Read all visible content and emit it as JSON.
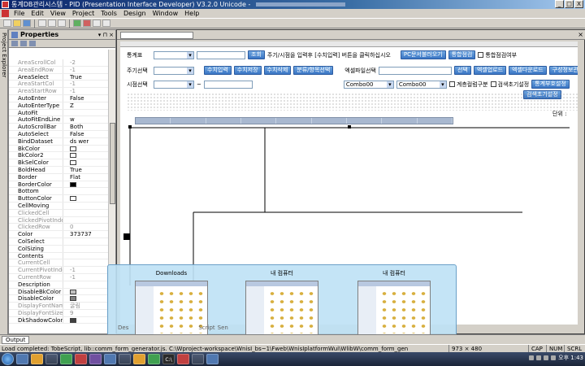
{
  "window": {
    "title": "통계DB관리시스템 - PID (Presentation Interface Developer) V3.2.0 Unicode - ",
    "controls": [
      "_",
      "□",
      "X"
    ]
  },
  "menu": [
    "File",
    "Edit",
    "View",
    "Project",
    "Tools",
    "Design",
    "Window",
    "Help"
  ],
  "side_tab": "Project Explorer",
  "properties": {
    "title": "Properties",
    "rows": [
      {
        "name": "AreaScrollCol",
        "value": "-2",
        "dim": true
      },
      {
        "name": "AreaEndRow",
        "value": "-1",
        "dim": true
      },
      {
        "name": "AreaSelect",
        "value": "True",
        "dim": false
      },
      {
        "name": "AreaStartCol",
        "value": "-1",
        "dim": true
      },
      {
        "name": "AreaStartRow",
        "value": "-1",
        "dim": true
      },
      {
        "name": "AutoEnter",
        "value": "False",
        "dim": false
      },
      {
        "name": "AutoEnterType",
        "value": "Z",
        "dim": false
      },
      {
        "name": "AutoFit",
        "value": "",
        "dim": false
      },
      {
        "name": "AutoFitEndLine",
        "value": "w",
        "dim": false
      },
      {
        "name": "AutoScrollBar",
        "value": "Both",
        "dim": false
      },
      {
        "name": "AutoSelect",
        "value": "False",
        "dim": false
      },
      {
        "name": "BindDataset",
        "value": "ds     wer",
        "dim": false
      },
      {
        "name": "BkColor",
        "value": "",
        "dim": false,
        "swatch": "#ffffff"
      },
      {
        "name": "BkColor2",
        "value": "",
        "dim": false,
        "swatch": "#ffffff"
      },
      {
        "name": "BkSelColor",
        "value": "",
        "dim": false,
        "swatch": "#ffffff"
      },
      {
        "name": "BoldHead",
        "value": "True",
        "dim": false
      },
      {
        "name": "Border",
        "value": "Flat",
        "dim": false
      },
      {
        "name": "BorderColor",
        "value": "",
        "dim": false,
        "swatch": "#000000"
      },
      {
        "name": "Bottom",
        "value": "",
        "dim": false
      },
      {
        "name": "ButtonColor",
        "value": "",
        "dim": false,
        "swatch": "#ffffff"
      },
      {
        "name": "CellMoving",
        "value": "",
        "dim": false
      },
      {
        "name": "ClickedCell",
        "value": "",
        "dim": true
      },
      {
        "name": "ClickedPivotIndex",
        "value": "",
        "dim": true
      },
      {
        "name": "ClickedRow",
        "value": "0",
        "dim": true
      },
      {
        "name": "Color",
        "value": "373737",
        "dim": false
      },
      {
        "name": "ColSelect",
        "value": "",
        "dim": false
      },
      {
        "name": "ColSizing",
        "value": "",
        "dim": false
      },
      {
        "name": "Contents",
        "value": "",
        "dim": false
      },
      {
        "name": "CurrentCell",
        "value": "",
        "dim": true
      },
      {
        "name": "CurrentPivotIndex",
        "value": "-1",
        "dim": true
      },
      {
        "name": "CurrentRow",
        "value": "-1",
        "dim": true
      },
      {
        "name": "Description",
        "value": "",
        "dim": false
      },
      {
        "name": "DisableBkColor",
        "value": "",
        "dim": false,
        "swatch": "#c0c0c0"
      },
      {
        "name": "DisableColor",
        "value": "",
        "dim": false,
        "swatch": "#808080"
      },
      {
        "name": "DisplayFontName",
        "value": "굴림",
        "dim": true
      },
      {
        "name": "DisplayFontSize",
        "value": "9",
        "dim": true
      },
      {
        "name": "DkShadowColor",
        "value": "",
        "dim": false,
        "swatch": "#404040"
      }
    ]
  },
  "form": {
    "label_stats_table": "통계표",
    "btn_lookup": "조회",
    "instruction": "주기/시점을 입력후 [수치입력] 버튼을 클릭하십시오",
    "btn_pc_doc": "PC문서불러오기",
    "btn_tong": "통합점검",
    "chk_tong_label": "통합점검여부",
    "label_period": "주기선택",
    "btn_value_input": "수치입력",
    "btn_value_save": "수치저장",
    "btn_value_delete": "수치삭제",
    "btn_category": "분류/항목선택",
    "label_excel_file": "엑셀파일선택",
    "btn_select": "선택",
    "btn_excel_upload": "엑셀업로드",
    "btn_excel_download": "엑셀다운로드",
    "btn_config": "구성정보관리",
    "label_time": "시점선택",
    "tilde": "~",
    "combo1": "Combo00",
    "combo2": "Combo00",
    "chk_hierarchy_label": "계층컬럼구분",
    "chk_search_label": "검색초기설정",
    "btn_stat_bumo": "통계부호설정",
    "btn_search_init": "검색초기설정",
    "unit_label": "단위 :"
  },
  "task_thumbnails": [
    {
      "caption": "Downloads"
    },
    {
      "caption": "내 컴퓨터"
    },
    {
      "caption": "내 컴퓨터"
    }
  ],
  "hidden_tabs": [
    "Des",
    "Script",
    "Sen"
  ],
  "output_tab": "Output",
  "status": {
    "message": "Load completed: TobeScript, lib::comm_form_generator.js. C:\\Wproject-workspace\\WnisI_bs~1\\Fweb\\WnisIplatformWui\\WlibW\\comm_form_generator.js ...",
    "coords": "973 × 480",
    "cap": "CAP",
    "num": "NUM",
    "scrl": "SCRL"
  },
  "taskbar": {
    "clock": "오후 1:43"
  },
  "colors": {
    "title_start": "#0a246a",
    "button_blue": "#3a76c4",
    "face": "#d4d0c8"
  }
}
